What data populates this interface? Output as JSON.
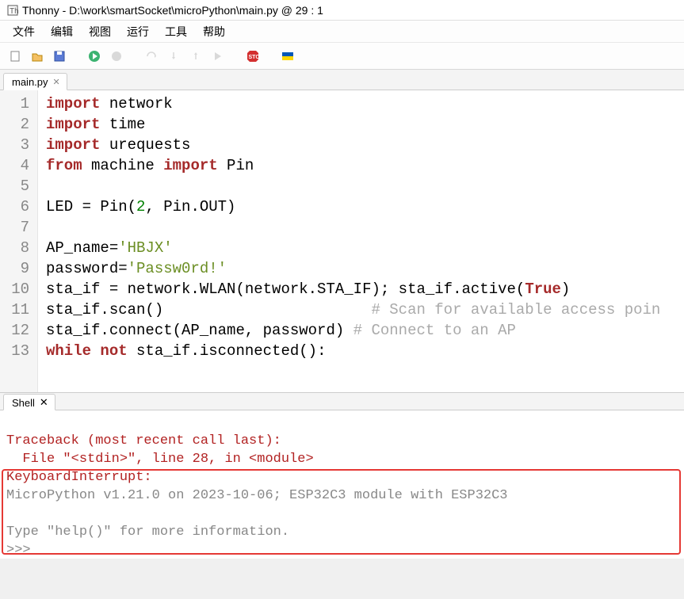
{
  "window": {
    "title": "Thonny  -  D:\\work\\smartSocket\\microPython\\main.py  @  29 : 1"
  },
  "menus": [
    "文件",
    "编辑",
    "视图",
    "运行",
    "工具",
    "帮助"
  ],
  "tabs": {
    "editor": "main.py",
    "shell": "Shell"
  },
  "code": {
    "lines": [
      {
        "n": "1",
        "tokens": [
          [
            "kw",
            "import"
          ],
          [
            "plain",
            " network"
          ]
        ]
      },
      {
        "n": "2",
        "tokens": [
          [
            "kw",
            "import"
          ],
          [
            "plain",
            " time"
          ]
        ]
      },
      {
        "n": "3",
        "tokens": [
          [
            "kw",
            "import"
          ],
          [
            "plain",
            " urequests"
          ]
        ]
      },
      {
        "n": "4",
        "tokens": [
          [
            "kw",
            "from"
          ],
          [
            "plain",
            " machine "
          ],
          [
            "kw",
            "import"
          ],
          [
            "plain",
            " Pin"
          ]
        ]
      },
      {
        "n": "5",
        "tokens": [
          [
            "plain",
            ""
          ]
        ]
      },
      {
        "n": "6",
        "tokens": [
          [
            "plain",
            "LED = Pin("
          ],
          [
            "num",
            "2"
          ],
          [
            "plain",
            ", Pin.OUT)"
          ]
        ]
      },
      {
        "n": "7",
        "tokens": [
          [
            "plain",
            ""
          ]
        ]
      },
      {
        "n": "8",
        "tokens": [
          [
            "plain",
            "AP_name="
          ],
          [
            "str",
            "'HBJX'"
          ]
        ]
      },
      {
        "n": "9",
        "tokens": [
          [
            "plain",
            "password="
          ],
          [
            "str",
            "'Passw0rd!'"
          ]
        ]
      },
      {
        "n": "10",
        "tokens": [
          [
            "plain",
            "sta_if = network.WLAN(network.STA_IF); sta_if.active("
          ],
          [
            "bool",
            "True"
          ],
          [
            "plain",
            ")"
          ]
        ]
      },
      {
        "n": "11",
        "tokens": [
          [
            "plain",
            "sta_if.scan()                       "
          ],
          [
            "comment",
            "# Scan for available access poin"
          ]
        ]
      },
      {
        "n": "12",
        "tokens": [
          [
            "plain",
            "sta_if.connect(AP_name, password) "
          ],
          [
            "comment",
            "# Connect to an AP"
          ]
        ]
      },
      {
        "n": "13",
        "tokens": [
          [
            "kw",
            "while not"
          ],
          [
            "plain",
            " sta_if.isconnected():"
          ]
        ]
      }
    ]
  },
  "shell": {
    "traceback": "Traceback (most recent call last):",
    "file": "  File \"<stdin>\", line 28, in <module>",
    "kbi": "KeyboardInterrupt: ",
    "banner1": "MicroPython v1.21.0 on 2023-10-06; ESP32C3 module with ESP32C3",
    "banner2": "Type \"help()\" for more information.",
    "prompt": ">>> "
  }
}
